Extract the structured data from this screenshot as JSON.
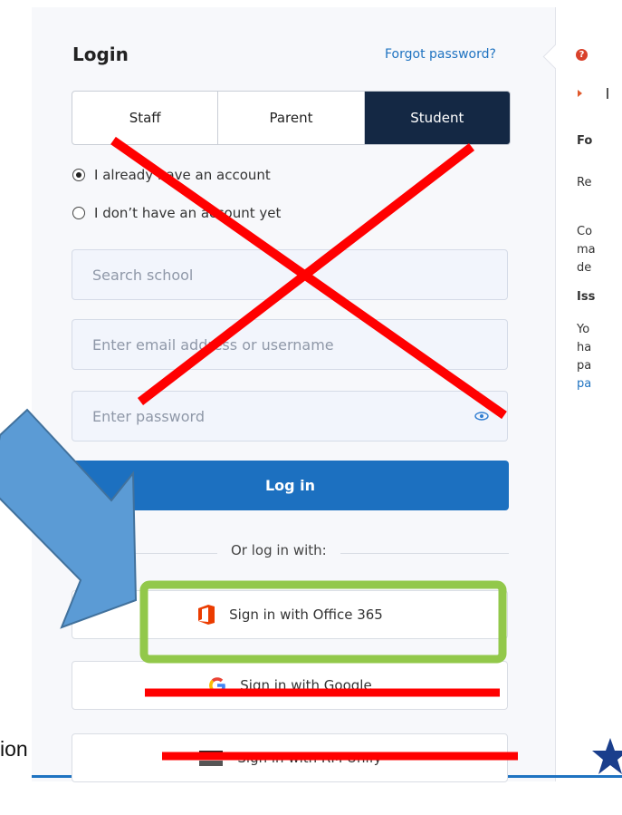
{
  "login": {
    "title": "Login",
    "forgot_link": "Forgot password?",
    "tabs": [
      {
        "label": "Staff",
        "active": false
      },
      {
        "label": "Parent",
        "active": false
      },
      {
        "label": "Student",
        "active": true
      }
    ],
    "account_options": [
      {
        "label": "I already have an account",
        "checked": true
      },
      {
        "label": "I don’t have an account yet",
        "checked": false
      }
    ],
    "search_placeholder": "Search school",
    "email_placeholder": "Enter email address or username",
    "password_placeholder": "Enter password",
    "login_button": "Log in",
    "divider_text": "Or log in with:",
    "sso_buttons": [
      {
        "label": "Sign in with Office 365",
        "icon": "office-365-icon"
      },
      {
        "label": "Sign in with Google",
        "icon": "google-icon"
      },
      {
        "label": "Sign in with RM Unify",
        "icon": "rm-unify-icon"
      }
    ]
  },
  "side_panel": {
    "lines": [
      "Fo",
      "Re",
      "Co",
      "ma",
      "de",
      "Iss",
      "Yo",
      "ha",
      "pa",
      "pa"
    ]
  },
  "left_cut_text": "ion",
  "annotations": {
    "cross_color": "#ff0000",
    "highlight_color": "#92c84a",
    "arrow_color": "#5b9bd5"
  },
  "colors": {
    "primary": "#1c70c0",
    "tab_active": "#142844",
    "link": "#1f73c1",
    "office_orange": "#eb3c00"
  }
}
